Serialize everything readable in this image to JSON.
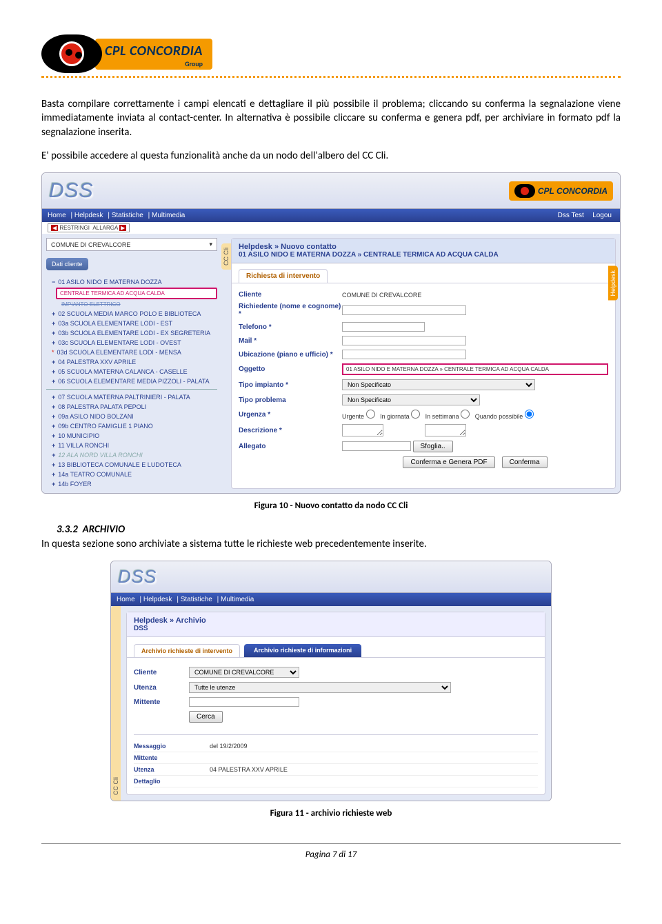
{
  "brand": {
    "name": "CPL CONCORDIA",
    "sub": "Group"
  },
  "paragraphs": {
    "p1": "Basta compilare correttamente i campi elencati e dettagliare il più possibile il problema; cliccando su conferma la segnalazione viene immediatamente inviata al contact-center. In alternativa è possibile cliccare su conferma e genera pdf, per archiviare in formato pdf la segnalazione inserita.",
    "p2": "E' possibile accedere al questa funzionalità anche da un nodo dell'albero del CC Cli."
  },
  "captions": {
    "c1": "Figura 10 - Nuovo contatto da nodo CC Cli",
    "c2": "Figura 11 - archivio richieste web"
  },
  "section": {
    "num": "3.3.2",
    "title": "Archivio"
  },
  "section_text": "In questa sezione sono archiviate a sistema tutte le richieste web precedentemente inserite.",
  "footer": "Pagina 7 di 17",
  "shot1": {
    "app": "DSS",
    "menu": [
      "Home",
      "Helpdesk",
      "Statistiche",
      "Multimedia"
    ],
    "menu_right": [
      "Dss Test",
      "Logou"
    ],
    "restringi": "RESTRINGI",
    "allarga": "ALLARGA",
    "vtab": "CC Cli",
    "side_tab_right": "Helpdesk",
    "combo": "COMUNE DI CREVALCORE",
    "dati_btn": "Dati cliente",
    "tree": {
      "root": "01 ASILO NIDO E MATERNA DOZZA",
      "highlight": "CENTRALE TERMICA AD ACQUA CALDA",
      "sub": "IMPIANTO ELETTRICO",
      "items": [
        "02 SCUOLA MEDIA MARCO POLO E BIBLIOTECA",
        "03a SCUOLA ELEMENTARE LODI - EST",
        "03b SCUOLA ELEMENTARE LODI - EX SEGRETERIA",
        "03c SCUOLA ELEMENTARE LODI - OVEST",
        "03d SCUOLA ELEMENTARE LODI - MENSA",
        "04 PALESTRA XXV APRILE",
        "05 SCUOLA MATERNA CALANCA - CASELLE",
        "06 SCUOLA ELEMENTARE MEDIA PIZZOLI - PALATA",
        "07 SCUOLA MATERNA PALTRINIERI - PALATA",
        "08 PALESTRA PALATA PEPOLI",
        "09a ASILO NIDO BOLZANI",
        "09b CENTRO FAMIGLIE 1 PIANO",
        "10 MUNICIPIO",
        "11 VILLA RONCHI",
        "12 ALA NORD VILLA RONCHI",
        "13 BIBLIOTECA COMUNALE E LUDOTECA",
        "14a TEATRO COMUNALE",
        "14b FOYER"
      ]
    },
    "form": {
      "breadcrumb": "Helpdesk » Nuovo contatto",
      "subtitle": "01 ASILO NIDO E MATERNA DOZZA » CENTRALE TERMICA AD ACQUA CALDA",
      "tab": "Richiesta di intervento",
      "labels": {
        "cliente": "Cliente",
        "richiedente": "Richiedente (nome e cognome) *",
        "telefono": "Telefono *",
        "mail": "Mail *",
        "ubicazione": "Ubicazione (piano e ufficio) *",
        "oggetto": "Oggetto",
        "tipo_impianto": "Tipo impianto *",
        "tipo_problema": "Tipo problema",
        "urgenza": "Urgenza *",
        "descrizione": "Descrizione *",
        "allegato": "Allegato"
      },
      "values": {
        "cliente": "COMUNE DI CREVALCORE",
        "oggetto": "01 ASILO NIDO E MATERNA DOZZA » CENTRALE TERMICA AD ACQUA CALDA",
        "tipo_impianto": "Non Specificato",
        "tipo_problema": "Non Specificato"
      },
      "urgenza_opts": [
        "Urgente",
        "In giornata",
        "In settimana",
        "Quando possibile"
      ],
      "buttons": {
        "sfoglia": "Sfoglia..",
        "conferma_pdf": "Conferma e Genera PDF",
        "conferma": "Conferma"
      }
    }
  },
  "shot2": {
    "app": "DSS",
    "menu": [
      "Home",
      "Helpdesk",
      "Statistiche",
      "Multimedia"
    ],
    "vtab": "CC Cli",
    "header": {
      "a": "Helpdesk » Archivio",
      "b": "DSS"
    },
    "tabs": {
      "a": "Archivio richieste di intervento",
      "b": "Archivio richieste di informazioni"
    },
    "filters": {
      "cliente_lbl": "Cliente",
      "cliente_val": "COMUNE DI CREVALCORE",
      "utenza_lbl": "Utenza",
      "utenza_val": "Tutte le utenze",
      "mittente_lbl": "Mittente",
      "cerca": "Cerca"
    },
    "result": {
      "messaggio_lbl": "Messaggio",
      "messaggio_val": "del 19/2/2009",
      "mittente_lbl": "Mittente",
      "utenza_lbl": "Utenza",
      "utenza_val": "04 PALESTRA XXV APRILE",
      "dettaglio_lbl": "Dettaglio"
    }
  }
}
